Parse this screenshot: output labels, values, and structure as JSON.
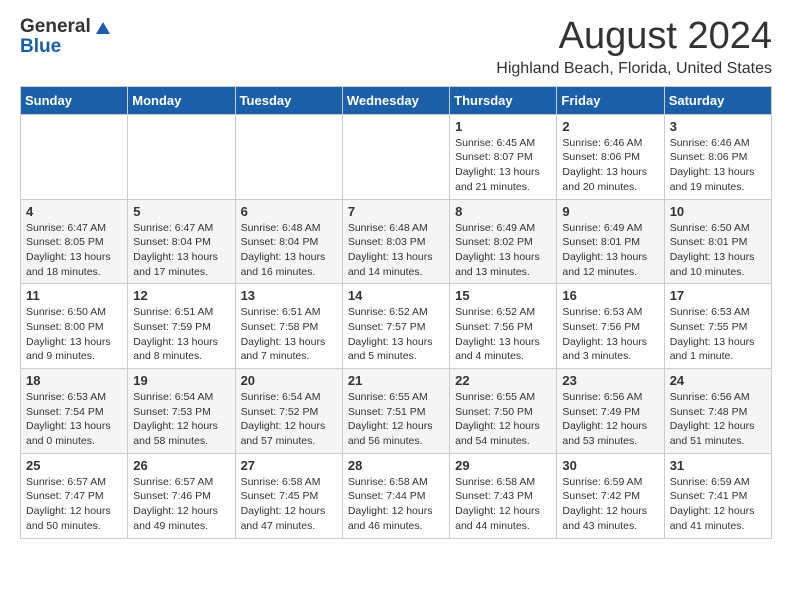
{
  "header": {
    "logo_general": "General",
    "logo_blue": "Blue",
    "main_title": "August 2024",
    "sub_title": "Highland Beach, Florida, United States"
  },
  "calendar": {
    "weekdays": [
      "Sunday",
      "Monday",
      "Tuesday",
      "Wednesday",
      "Thursday",
      "Friday",
      "Saturday"
    ],
    "weeks": [
      [
        {
          "day": "",
          "info": ""
        },
        {
          "day": "",
          "info": ""
        },
        {
          "day": "",
          "info": ""
        },
        {
          "day": "",
          "info": ""
        },
        {
          "day": "1",
          "info": "Sunrise: 6:45 AM\nSunset: 8:07 PM\nDaylight: 13 hours\nand 21 minutes."
        },
        {
          "day": "2",
          "info": "Sunrise: 6:46 AM\nSunset: 8:06 PM\nDaylight: 13 hours\nand 20 minutes."
        },
        {
          "day": "3",
          "info": "Sunrise: 6:46 AM\nSunset: 8:06 PM\nDaylight: 13 hours\nand 19 minutes."
        }
      ],
      [
        {
          "day": "4",
          "info": "Sunrise: 6:47 AM\nSunset: 8:05 PM\nDaylight: 13 hours\nand 18 minutes."
        },
        {
          "day": "5",
          "info": "Sunrise: 6:47 AM\nSunset: 8:04 PM\nDaylight: 13 hours\nand 17 minutes."
        },
        {
          "day": "6",
          "info": "Sunrise: 6:48 AM\nSunset: 8:04 PM\nDaylight: 13 hours\nand 16 minutes."
        },
        {
          "day": "7",
          "info": "Sunrise: 6:48 AM\nSunset: 8:03 PM\nDaylight: 13 hours\nand 14 minutes."
        },
        {
          "day": "8",
          "info": "Sunrise: 6:49 AM\nSunset: 8:02 PM\nDaylight: 13 hours\nand 13 minutes."
        },
        {
          "day": "9",
          "info": "Sunrise: 6:49 AM\nSunset: 8:01 PM\nDaylight: 13 hours\nand 12 minutes."
        },
        {
          "day": "10",
          "info": "Sunrise: 6:50 AM\nSunset: 8:01 PM\nDaylight: 13 hours\nand 10 minutes."
        }
      ],
      [
        {
          "day": "11",
          "info": "Sunrise: 6:50 AM\nSunset: 8:00 PM\nDaylight: 13 hours\nand 9 minutes."
        },
        {
          "day": "12",
          "info": "Sunrise: 6:51 AM\nSunset: 7:59 PM\nDaylight: 13 hours\nand 8 minutes."
        },
        {
          "day": "13",
          "info": "Sunrise: 6:51 AM\nSunset: 7:58 PM\nDaylight: 13 hours\nand 7 minutes."
        },
        {
          "day": "14",
          "info": "Sunrise: 6:52 AM\nSunset: 7:57 PM\nDaylight: 13 hours\nand 5 minutes."
        },
        {
          "day": "15",
          "info": "Sunrise: 6:52 AM\nSunset: 7:56 PM\nDaylight: 13 hours\nand 4 minutes."
        },
        {
          "day": "16",
          "info": "Sunrise: 6:53 AM\nSunset: 7:56 PM\nDaylight: 13 hours\nand 3 minutes."
        },
        {
          "day": "17",
          "info": "Sunrise: 6:53 AM\nSunset: 7:55 PM\nDaylight: 13 hours\nand 1 minute."
        }
      ],
      [
        {
          "day": "18",
          "info": "Sunrise: 6:53 AM\nSunset: 7:54 PM\nDaylight: 13 hours\nand 0 minutes."
        },
        {
          "day": "19",
          "info": "Sunrise: 6:54 AM\nSunset: 7:53 PM\nDaylight: 12 hours\nand 58 minutes."
        },
        {
          "day": "20",
          "info": "Sunrise: 6:54 AM\nSunset: 7:52 PM\nDaylight: 12 hours\nand 57 minutes."
        },
        {
          "day": "21",
          "info": "Sunrise: 6:55 AM\nSunset: 7:51 PM\nDaylight: 12 hours\nand 56 minutes."
        },
        {
          "day": "22",
          "info": "Sunrise: 6:55 AM\nSunset: 7:50 PM\nDaylight: 12 hours\nand 54 minutes."
        },
        {
          "day": "23",
          "info": "Sunrise: 6:56 AM\nSunset: 7:49 PM\nDaylight: 12 hours\nand 53 minutes."
        },
        {
          "day": "24",
          "info": "Sunrise: 6:56 AM\nSunset: 7:48 PM\nDaylight: 12 hours\nand 51 minutes."
        }
      ],
      [
        {
          "day": "25",
          "info": "Sunrise: 6:57 AM\nSunset: 7:47 PM\nDaylight: 12 hours\nand 50 minutes."
        },
        {
          "day": "26",
          "info": "Sunrise: 6:57 AM\nSunset: 7:46 PM\nDaylight: 12 hours\nand 49 minutes."
        },
        {
          "day": "27",
          "info": "Sunrise: 6:58 AM\nSunset: 7:45 PM\nDaylight: 12 hours\nand 47 minutes."
        },
        {
          "day": "28",
          "info": "Sunrise: 6:58 AM\nSunset: 7:44 PM\nDaylight: 12 hours\nand 46 minutes."
        },
        {
          "day": "29",
          "info": "Sunrise: 6:58 AM\nSunset: 7:43 PM\nDaylight: 12 hours\nand 44 minutes."
        },
        {
          "day": "30",
          "info": "Sunrise: 6:59 AM\nSunset: 7:42 PM\nDaylight: 12 hours\nand 43 minutes."
        },
        {
          "day": "31",
          "info": "Sunrise: 6:59 AM\nSunset: 7:41 PM\nDaylight: 12 hours\nand 41 minutes."
        }
      ]
    ]
  }
}
